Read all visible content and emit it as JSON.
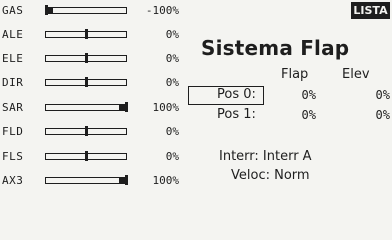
{
  "header": {
    "badge": "LISTA"
  },
  "title": "Sistema Flap",
  "channels": [
    {
      "label": "GAS",
      "value": "-100%",
      "level": -100
    },
    {
      "label": "ALE",
      "value": "0%",
      "level": 0
    },
    {
      "label": "ELE",
      "value": "0%",
      "level": 0
    },
    {
      "label": "DIR",
      "value": "0%",
      "level": 0
    },
    {
      "label": "SAR",
      "value": "100%",
      "level": 100
    },
    {
      "label": "FLD",
      "value": "0%",
      "level": 0
    },
    {
      "label": "FLS",
      "value": "0%",
      "level": 0
    },
    {
      "label": "AX3",
      "value": "100%",
      "level": 100
    }
  ],
  "flap_table": {
    "headers": {
      "flap": "Flap",
      "elev": "Elev"
    },
    "rows": [
      {
        "label": "Pos 0:",
        "flap": "0%",
        "elev": "0%",
        "selected": true
      },
      {
        "label": "Pos 1:",
        "flap": "0%",
        "elev": "0%",
        "selected": false
      }
    ]
  },
  "interr": {
    "label": "Interr:",
    "value": "Interr A"
  },
  "veloc": {
    "label": "Veloc:",
    "value": "Norm"
  }
}
